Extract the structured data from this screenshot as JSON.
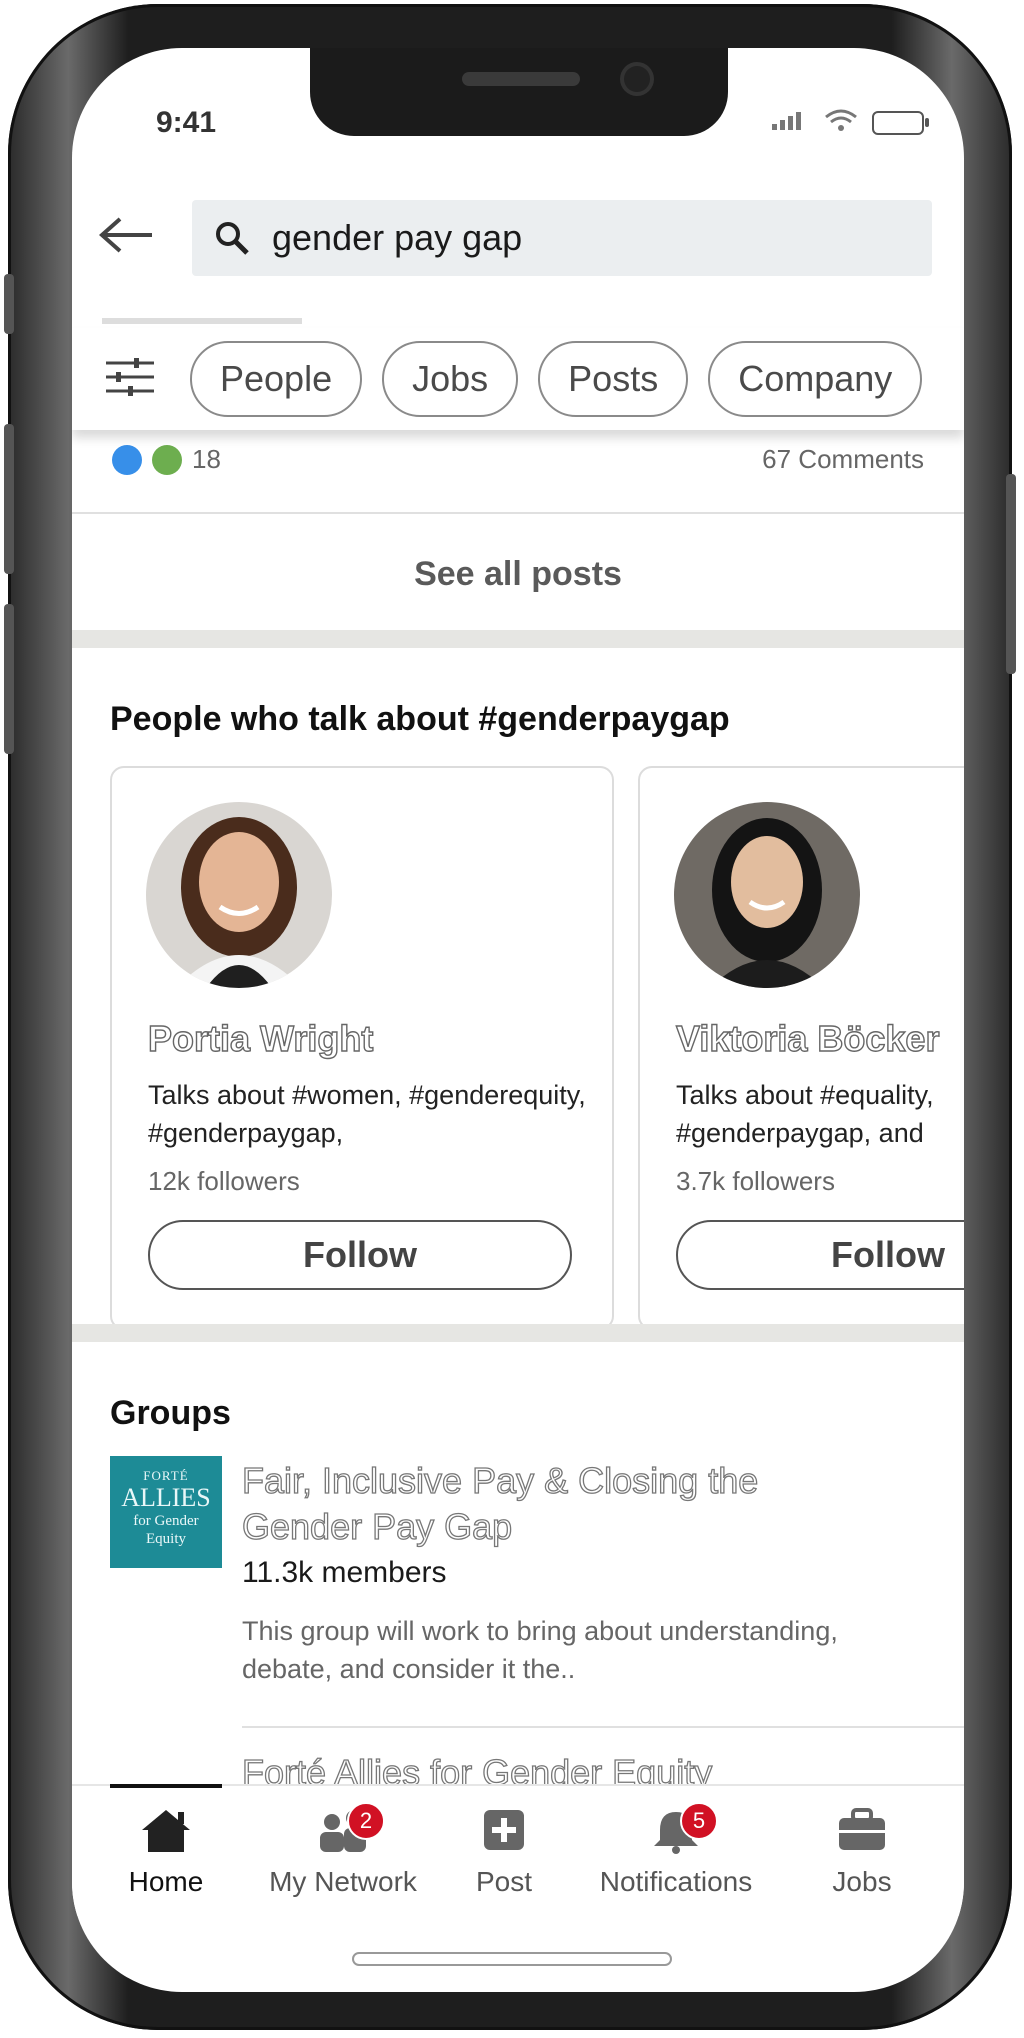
{
  "status_bar": {
    "time": "9:41"
  },
  "search": {
    "query": "gender pay gap"
  },
  "filters": {
    "chips": [
      "People",
      "Jobs",
      "Posts",
      "Company"
    ]
  },
  "post_summary": {
    "reaction_count": "18",
    "comments": "67 Comments"
  },
  "see_all_posts": "See all posts",
  "people_section": {
    "title": "People who talk about #genderpaygap",
    "people": [
      {
        "name": "Portia Wright",
        "talks": "Talks about #women, #genderequity, #genderpaygap,",
        "followers": "12k followers",
        "button": "Follow"
      },
      {
        "name": "Viktoria Böcker",
        "talks": "Talks about #equality, #genderpaygap, and",
        "followers": "3.7k followers",
        "button": "Follow"
      }
    ]
  },
  "groups_section": {
    "title": "Groups",
    "groups": [
      {
        "logo_lines": [
          "FORTÉ",
          "ALLIES",
          "for Gender",
          "Equity"
        ],
        "name": "Fair, Inclusive Pay & Closing the Gender Pay Gap",
        "members": "11.3k members",
        "description": "This group will work to bring about understanding, debate, and consider it the.."
      },
      {
        "name": "Forté Allies for Gender Equity"
      }
    ]
  },
  "bottom_nav": {
    "items": [
      {
        "label": "Home",
        "icon": "home-icon",
        "active": true
      },
      {
        "label": "My Network",
        "icon": "network-icon",
        "badge": "2"
      },
      {
        "label": "Post",
        "icon": "post-icon"
      },
      {
        "label": "Notifications",
        "icon": "bell-icon",
        "badge": "5"
      },
      {
        "label": "Jobs",
        "icon": "briefcase-icon"
      }
    ]
  },
  "colors": {
    "badge": "#d11124",
    "group_logo": "#1d8b96",
    "search_bg": "#ebeef0"
  }
}
